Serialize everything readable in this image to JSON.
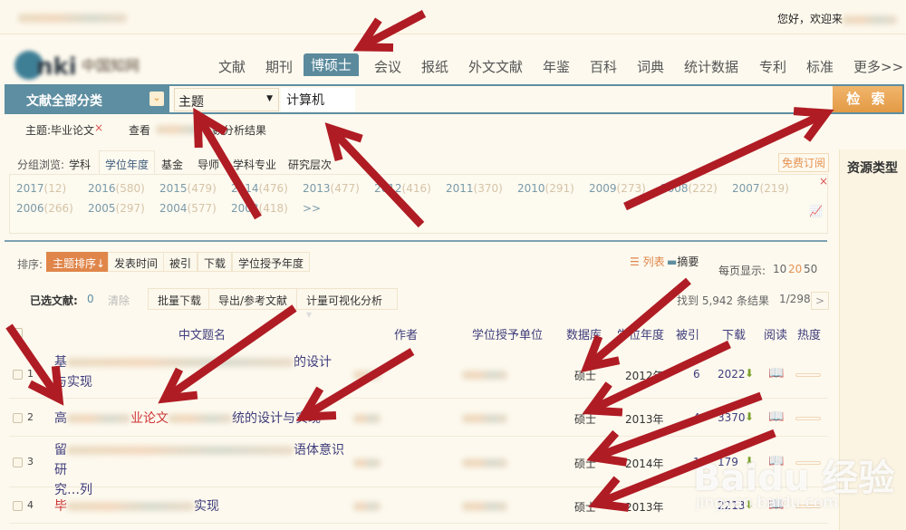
{
  "topbar": {
    "greeting": "您好，欢迎来"
  },
  "logo": {
    "text": "cnki 中国知网"
  },
  "nav": {
    "items": [
      {
        "label": "文献"
      },
      {
        "label": "期刊"
      },
      {
        "label": "博硕士",
        "active": true
      },
      {
        "label": "会议"
      },
      {
        "label": "报纸"
      },
      {
        "label": "外文文献"
      },
      {
        "label": "年鉴"
      },
      {
        "label": "百科"
      },
      {
        "label": "词典"
      },
      {
        "label": "统计数据"
      },
      {
        "label": "专利"
      },
      {
        "label": "标准"
      },
      {
        "label": "更多>>"
      }
    ]
  },
  "search": {
    "category_label": "文献全部分类",
    "field_select": "主题",
    "query": "计算机",
    "button": "检 索"
  },
  "filters": {
    "chip": "主题:毕业论文",
    "chip_close": "×",
    "view_label": "查看",
    "analysis_suffix": "数分析结果"
  },
  "group_browse": {
    "label": "分组浏览:",
    "tabs": [
      "学科",
      "学位年度",
      "基金",
      "导师",
      "学科专业",
      "研究层次"
    ],
    "active": "学位年度",
    "subscribe": "免费订阅",
    "close": "×",
    "years": [
      {
        "year": "2017",
        "count": "(12)"
      },
      {
        "year": "2016",
        "count": "(580)"
      },
      {
        "year": "2015",
        "count": "(479)"
      },
      {
        "year": "2014",
        "count": "(476)"
      },
      {
        "year": "2013",
        "count": "(477)"
      },
      {
        "year": "2012",
        "count": "(416)"
      },
      {
        "year": "2011",
        "count": "(370)"
      },
      {
        "year": "2010",
        "count": "(291)"
      },
      {
        "year": "2009",
        "count": "(273)"
      },
      {
        "year": "2008",
        "count": "(222)"
      },
      {
        "year": "2007",
        "count": "(219)"
      },
      {
        "year": "2006",
        "count": "(266)"
      },
      {
        "year": "2005",
        "count": "(297)"
      },
      {
        "year": "2004",
        "count": "(577)"
      },
      {
        "year": "2003",
        "count": "(418)"
      }
    ],
    "more": ">>"
  },
  "sidebar": {
    "title": "资源类型"
  },
  "sort": {
    "label": "排序:",
    "options": [
      "主题排序↓",
      "发表时间",
      "被引",
      "下载",
      "学位授予年度"
    ],
    "active": "主题排序↓",
    "view_list": "列表",
    "view_abstract": "摘要",
    "per_page_label": "每页显示:",
    "per_page": [
      "10",
      "20",
      "50"
    ],
    "per_page_active": "20"
  },
  "toolbar": {
    "selected_label": "已选文献:",
    "selected_count": "0",
    "clear": "清除",
    "batch_download": "批量下载",
    "export": "导出/参考文献",
    "visual_analysis": "计量可视化分析",
    "result_text": "找到 5,942 条结果",
    "page": "1/298",
    "next": ">"
  },
  "table": {
    "headers": [
      "中文题名",
      "作者",
      "学位授予单位",
      "数据库",
      "学位年度",
      "被引",
      "下载",
      "阅读",
      "热度"
    ],
    "rows": [
      {
        "num": "1",
        "title_start": "基",
        "title_hl": "",
        "title_end": "的设计",
        "title_line2": "与实现",
        "db": "硕士",
        "year": "2012年",
        "cites": "6",
        "downloads": "2022"
      },
      {
        "num": "2",
        "title_start": "高",
        "title_hl": "业论文",
        "title_end": "统的设计与实现",
        "title_line2": "",
        "db": "硕士",
        "year": "2013年",
        "cites": "4",
        "downloads": "3370"
      },
      {
        "num": "3",
        "title_start": "留",
        "title_hl": "",
        "title_end": "语体意识研",
        "title_line2": "究…列",
        "db": "硕士",
        "year": "2014年",
        "cites": "1",
        "downloads": "179"
      },
      {
        "num": "4",
        "title_start": "毕",
        "title_hl": "",
        "title_end": "实现",
        "title_line2": "",
        "db": "硕士",
        "year": "2013年",
        "cites": "",
        "downloads": "2213"
      }
    ]
  },
  "watermark": {
    "brand": "Bai du 经验",
    "url": "jingyan.baidu.com"
  },
  "colors": {
    "accent_blue": "#5e8ea1",
    "accent_orange": "#e0864b",
    "annotation_red": "#b01c24",
    "background": "#fdf9ee"
  }
}
